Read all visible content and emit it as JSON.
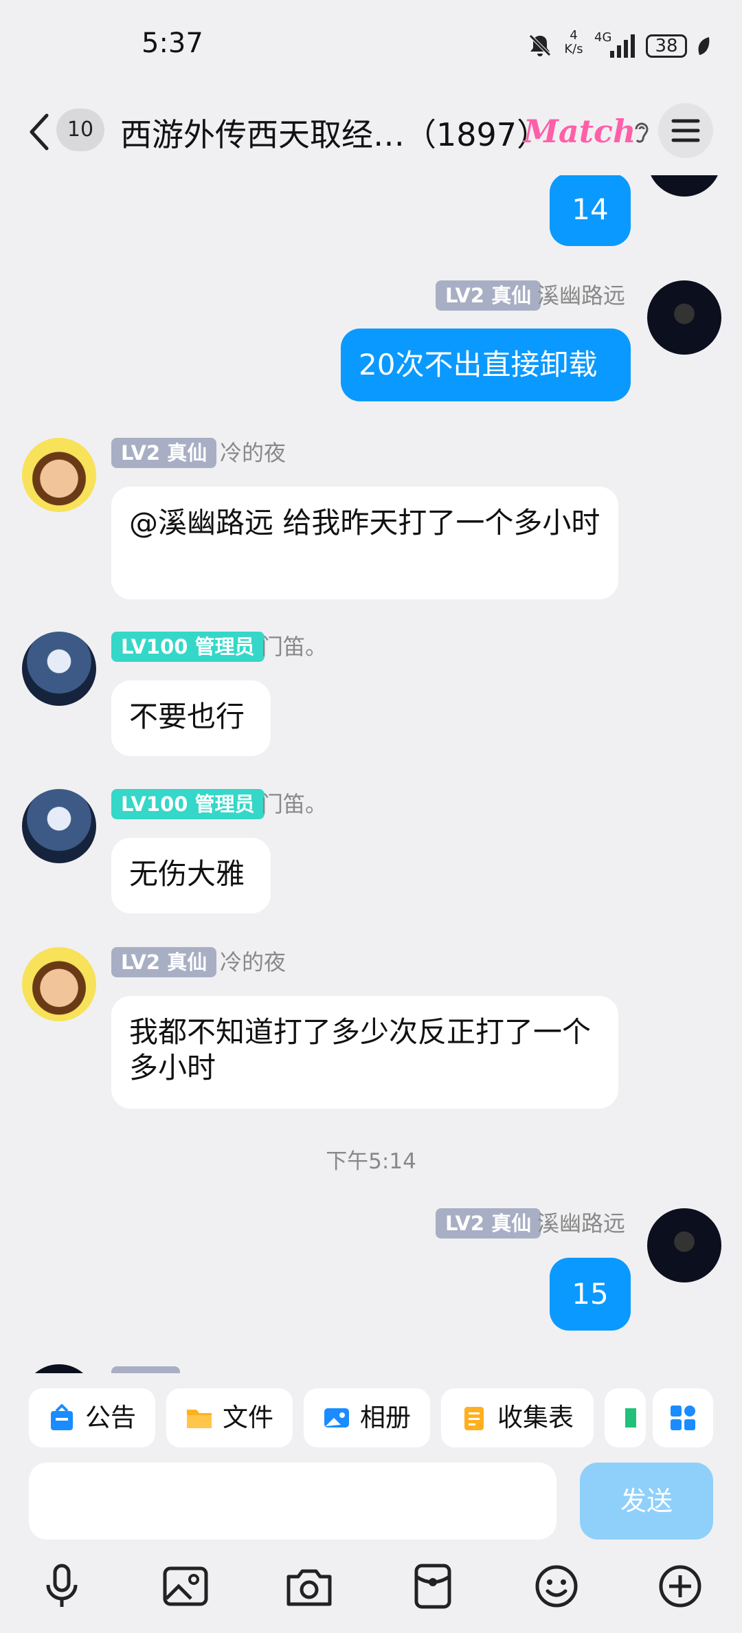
{
  "status_bar": {
    "time": "5:37",
    "net_speed_top": "4",
    "net_speed_unit": "K/s",
    "network": "4G",
    "battery": "38"
  },
  "header": {
    "unread_count": "10",
    "title": "西游外传西天取经…（1897）",
    "match_label": "Match"
  },
  "messages": [
    {
      "text": "14"
    },
    {
      "level": "LV2 真仙",
      "name": "溪幽路远",
      "text": "20次不出直接卸载"
    },
    {
      "level": "LV2 真仙",
      "name": "冷的夜",
      "text": "@溪幽路远 给我昨天打了一个多小时"
    },
    {
      "level": "LV100 管理员",
      "name": "门笛。",
      "text": "不要也行"
    },
    {
      "level": "LV100 管理员",
      "name": "门笛。",
      "text": "无伤大雅"
    },
    {
      "level": "LV2 真仙",
      "name": "冷的夜",
      "text": "我都不知道打了多少次反正打了一个多小时"
    },
    {
      "level": "LV2 真仙",
      "name": "溪幽路远",
      "text": "15"
    }
  ],
  "timestamp": "下午5:14",
  "quick_actions": [
    {
      "label": "公告",
      "icon": "announcement-icon"
    },
    {
      "label": "文件",
      "icon": "folder-icon"
    },
    {
      "label": "相册",
      "icon": "album-icon"
    },
    {
      "label": "收集表",
      "icon": "form-icon"
    }
  ],
  "composer": {
    "send_label": "发送"
  },
  "toolbar": [
    "microphone-icon",
    "image-icon",
    "camera-icon",
    "red-packet-icon",
    "emoji-icon",
    "plus-icon"
  ]
}
